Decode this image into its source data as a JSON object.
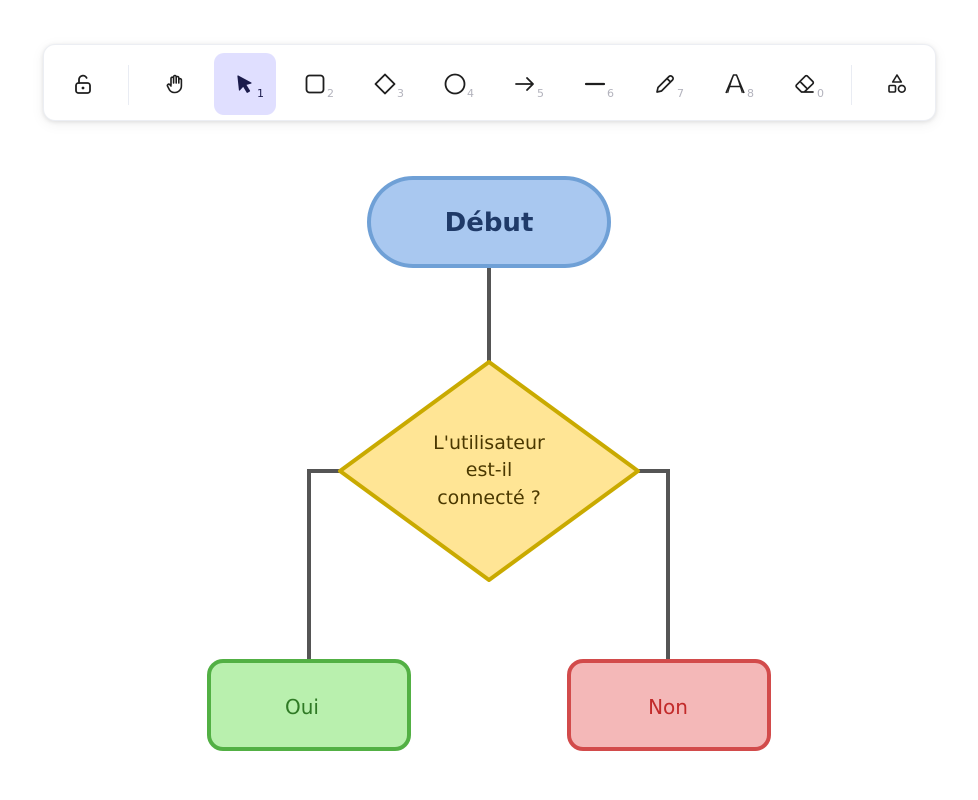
{
  "toolbar": {
    "tools": [
      {
        "name": "lock",
        "key": ""
      },
      {
        "name": "hand",
        "key": ""
      },
      {
        "name": "selection",
        "key": "1"
      },
      {
        "name": "rectangle",
        "key": "2"
      },
      {
        "name": "diamond",
        "key": "3"
      },
      {
        "name": "ellipse",
        "key": "4"
      },
      {
        "name": "arrow",
        "key": "5"
      },
      {
        "name": "line",
        "key": "6"
      },
      {
        "name": "draw",
        "key": "7"
      },
      {
        "name": "text",
        "key": "8"
      },
      {
        "name": "eraser",
        "key": "0"
      },
      {
        "name": "library",
        "key": ""
      }
    ],
    "active_tool": "selection",
    "active_color": "#e0dfff"
  },
  "flowchart": {
    "start": {
      "label": "Début",
      "fill": "#a9c8f0",
      "stroke": "#6fa0d6",
      "text_color": "#1f3a68"
    },
    "decision": {
      "lines": [
        "L'utilisateur",
        "est-il",
        "connecté ?"
      ],
      "fill": "#ffe595",
      "stroke": "#c9aa00",
      "text_color": "#4a3800"
    },
    "yes": {
      "label": "Oui",
      "fill": "#b9f0ae",
      "stroke": "#52b044",
      "text_color": "#2f7a25"
    },
    "no": {
      "label": "Non",
      "fill": "#f4b8b8",
      "stroke": "#d24b4b",
      "text_color": "#c22a2a"
    },
    "connector_color": "#555555"
  }
}
